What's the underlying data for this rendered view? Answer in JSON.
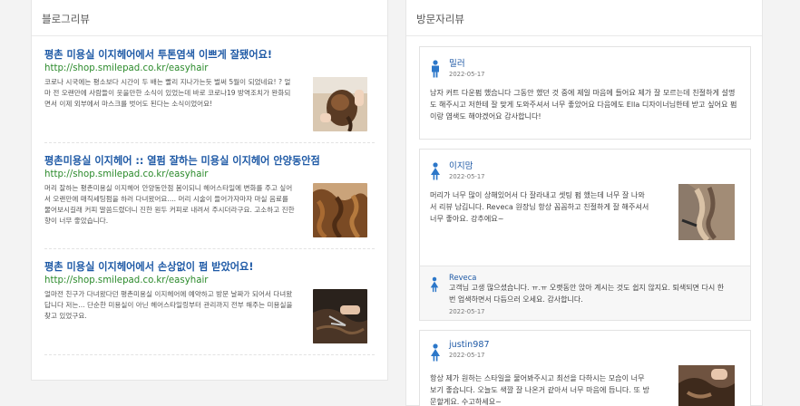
{
  "blog": {
    "header": "블로그리뷰",
    "items": [
      {
        "title": "평촌 미용실 이지헤어에서 투톤염색 이쁘게 잘됐어요!",
        "url": "http://shop.smilepad.co.kr/easyhair",
        "snippet": "코로나 시국에는 평소보다 시간이 두 배는 빨리 지나가는듯 벌써 5월이 되었네요! ? 얼마 전 오랜만에 사람들이 웃을만한 소식이 있었는데 바로 코로나19 방역조치가 완화되면서 이제 외부에서 마스크를 벗어도 된다는 소식이었어요!"
      },
      {
        "title": "평촌미용실 이지헤어 :: 열펌 잘하는 미용실 이지헤어 안양동안점",
        "url": "http://shop.smilepad.co.kr/easyhair",
        "snippet": "머리 잘하는 평촌미용실 이지헤어 안양동안점 봄이되니 헤어스타일에 변화를 주고 싶어서 오랜만에 매직세팅펌을 하러 다녀왔어요.... 머리 시술이 들어가자마자 마실 음료를 물어보시길래 커피 말씀드렸더니 진한 원두 커피로 내려서 주시더라구요. 고소하고 진한 향이 너무 좋았습니다."
      },
      {
        "title": "평촌 미용실 이지헤어에서 손상없이 펌 받았어요!",
        "url": "http://shop.smilepad.co.kr/easyhair",
        "snippet": "얼마전 친구가 다녀왔다던 평촌미용실 이지헤어에 예약하고 방문 날짜가 되어서 다녀왔답니다 저는... 단순한 미용실이 아닌 헤어스타일링부터 관리까지 전부 해주는 미용실을 찾고 있었구요."
      }
    ]
  },
  "visit": {
    "header": "방문자리뷰",
    "reviews": [
      {
        "name": "밀러",
        "date": "2022-05-17",
        "gender": "male",
        "text": "남자 커트 다운펌 했습니다 그동안 했던 것 중에 제일 마음에 들어요 제가 잘 모르는데 친절하게 설명도 해주시고 저한테 잘 맞게 도와주셔서 너무 좋았어요 다음에도 Ella 디자이너님한테 받고 싶어요 펌이랑 염색도 해야겠어요 감사합니다!"
      },
      {
        "name": "이지맘",
        "date": "2022-05-17",
        "gender": "female",
        "text": "머리가 너무 많이 상해있어서 다 잘라내고 셋팅 펌 했는데 너무 잘 나와서 리뷰 남깁니다. Reveca 원장님 항상 꼼꼼하고 친절하게 잘 해주셔서 너무 좋아요. 강추에요~",
        "reply": {
          "name": "Reveca",
          "text": "고객님 고생 많으셨습니다. ㅠ.ㅠ 오랫동안 앉아 계시는 것도 쉽지 않지요. 퇴색되면 다시 한번 업색하면서 다듬으러 오세요. 감사합니다.",
          "date": "2022-05-17"
        }
      },
      {
        "name": "justin987",
        "date": "2022-05-17",
        "gender": "female",
        "text": "항상 제가 원하는 스타일을 물어봐주시고 최선을 다하시는 모습이 너무 보기 좋습니다. 오늘도 색깔 잘 나온거 같아서 너무 마음에 듭니다. 또 방문할게요. 수고하세요~"
      }
    ]
  },
  "colors": {
    "link_blue": "#1f5aa6",
    "url_green": "#2b8a2b",
    "male_icon": "#2c77c9",
    "female_icon": "#2c77c9"
  }
}
